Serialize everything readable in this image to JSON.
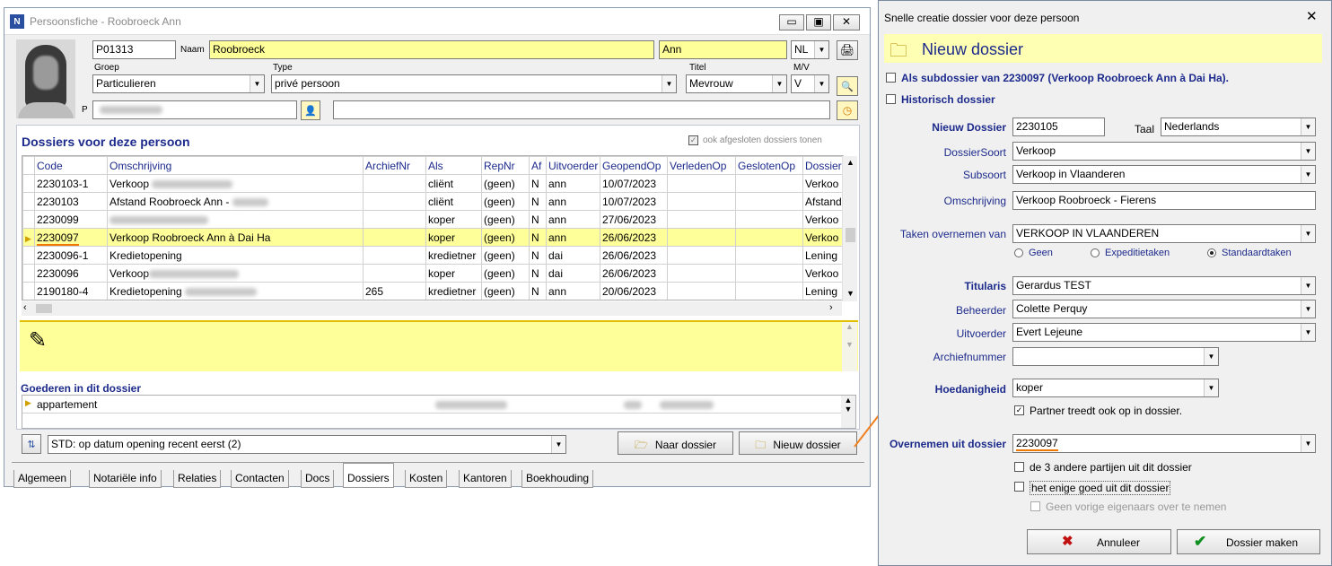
{
  "left": {
    "title": "Persoonsfiche - Roobroeck Ann",
    "code": "P01313",
    "naam_label": "Naam",
    "lastname": "Roobroeck",
    "firstname": "Ann",
    "lang": "NL",
    "groep_label": "Groep",
    "groep": "Particulieren",
    "type_label": "Type",
    "type": "privé persoon",
    "titel_label": "Titel",
    "titel": "Mevrouw",
    "mv_label": "M/V",
    "mv": "V",
    "p_label": "P",
    "section_title": "Dossiers voor deze persoon",
    "closed_label": "ook afgesloten dossiers tonen",
    "columns": [
      "Code",
      "Omschrijving",
      "ArchiefNr",
      "Als",
      "RepNr",
      "Af",
      "Uitvoerder",
      "GeopendOp",
      "VerledenOp",
      "GeslotenOp",
      "Dossier"
    ],
    "rows": [
      [
        "2230103-1",
        "Verkoop",
        "",
        "cliënt",
        "(geen)",
        "N",
        "ann",
        "10/07/2023",
        "",
        "",
        "Verkoo"
      ],
      [
        "2230103",
        "Afstand Roobroeck Ann -",
        "",
        "cliënt",
        "(geen)",
        "N",
        "ann",
        "10/07/2023",
        "",
        "",
        "Afstand"
      ],
      [
        "2230099",
        "",
        "",
        "koper",
        "(geen)",
        "N",
        "ann",
        "27/06/2023",
        "",
        "",
        "Verkoo"
      ],
      [
        "2230097",
        "Verkoop Roobroeck Ann à Dai Ha",
        "",
        "koper",
        "(geen)",
        "N",
        "ann",
        "26/06/2023",
        "",
        "",
        "Verkoo"
      ],
      [
        "2230096-1",
        "Kredietopening",
        "",
        "kredietner",
        "(geen)",
        "N",
        "dai",
        "26/06/2023",
        "",
        "",
        "Lening"
      ],
      [
        "2230096",
        "Verkoop",
        "",
        "koper",
        "(geen)",
        "N",
        "dai",
        "26/06/2023",
        "",
        "",
        "Verkoo"
      ],
      [
        "2190180-4",
        "Kredietopening",
        "265",
        "kredietner",
        "(geen)",
        "N",
        "ann",
        "20/06/2023",
        "",
        "",
        "Lening"
      ]
    ],
    "goederen_title": "Goederen in dit dossier",
    "goed": "appartement",
    "sort": "STD: op datum opening recent eerst (2)",
    "naar_dossier": "Naar dossier",
    "nieuw_dossier": "Nieuw dossier",
    "tabs": [
      "Algemeen",
      "Notariële info",
      "Relaties",
      "Contacten",
      "Docs",
      "Dossiers",
      "Kosten",
      "Kantoren",
      "Boekhouding"
    ]
  },
  "right": {
    "title": "Snelle creatie dossier voor deze persoon",
    "header": "Nieuw dossier",
    "subdossier": "Als subdossier van 2230097 (Verkoop Roobroeck Ann à Dai Ha).",
    "historisch": "Historisch dossier",
    "nieuw_label": "Nieuw Dossier",
    "nieuw_value": "2230105",
    "taal_label": "Taal",
    "taal_value": "Nederlands",
    "soort_label": "DossierSoort",
    "soort_value": "Verkoop",
    "subsoort_label": "Subsoort",
    "subsoort_value": "Verkoop in Vlaanderen",
    "omschr_label": "Omschrijving",
    "omschr_value": "Verkoop Roobroeck - Fierens",
    "taken_label": "Taken overnemen van",
    "taken_value": "VERKOOP IN VLAANDEREN",
    "radio": [
      "Geen",
      "Expeditietaken",
      "Standaardtaken"
    ],
    "titularis_label": "Titularis",
    "titularis_value": "Gerardus TEST",
    "beheerder_label": "Beheerder",
    "beheerder_value": "Colette Perquy",
    "uitvoerder_label": "Uitvoerder",
    "uitvoerder_value": "Evert Lejeune",
    "archief_label": "Archiefnummer",
    "archief_value": "",
    "hoed_label": "Hoedanigheid",
    "hoed_value": "koper",
    "partner": "Partner treedt ook op in dossier.",
    "over_label": "Overnemen uit dossier",
    "over_value": "2230097",
    "chk1": "de 3 andere partijen uit dit dossier",
    "chk2": "het enige goed uit dit dossier",
    "chk3": "Geen vorige eigenaars over te nemen",
    "annuleer": "Annuleer",
    "maken": "Dossier maken"
  }
}
